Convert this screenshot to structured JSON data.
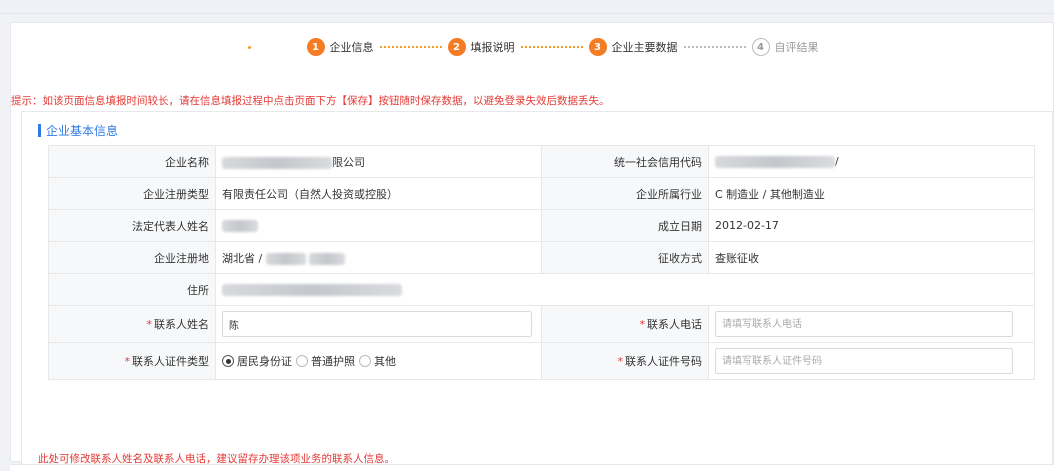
{
  "steps": [
    {
      "num": "1",
      "label": "企业信息",
      "state": "active"
    },
    {
      "num": "2",
      "label": "填报说明",
      "state": "active"
    },
    {
      "num": "3",
      "label": "企业主要数据",
      "state": "active"
    },
    {
      "num": "4",
      "label": "自评结果",
      "state": "inactive"
    }
  ],
  "notice": "提示：如该页面信息填报时间较长，请在信息填报过程中点击页面下方【保存】按钮随时保存数据，以避免登录失效后数据丢失。",
  "section": {
    "title": "企业基本信息",
    "labels": {
      "company_name": "企业名称",
      "credit_code": "统一社会信用代码",
      "reg_type": "企业注册类型",
      "industry": "企业所属行业",
      "legal_rep": "法定代表人姓名",
      "found_date": "成立日期",
      "reg_place": "企业注册地",
      "tax_method": "征收方式",
      "address": "住所",
      "contact_name": "联系人姓名",
      "contact_phone": "联系人电话",
      "id_type": "联系人证件类型",
      "id_number": "联系人证件号码"
    },
    "values": {
      "company_name_suffix": "限公司",
      "credit_code_suffix": "/",
      "reg_type": "有限责任公司（自然人投资或控股）",
      "industry": "C 制造业 / 其他制造业",
      "found_date": "2012-02-17",
      "reg_place_prefix": "湖北省 /",
      "tax_method": "查账征收",
      "contact_name_value": "陈",
      "contact_phone_placeholder": "请填写联系人电话",
      "id_number_placeholder": "请填写联系人证件号码"
    },
    "id_type_options": [
      {
        "label": "居民身份证",
        "checked": true
      },
      {
        "label": "普通护照",
        "checked": false
      },
      {
        "label": "其他",
        "checked": false
      }
    ],
    "required_mark": "*",
    "footnote": "此处可修改联系人姓名及联系人电话，建议留存办理该项业务的联系人信息。"
  },
  "colors": {
    "accent_orange": "#f47c24",
    "accent_blue": "#2f7ae5",
    "warning_red": "#e53935"
  }
}
